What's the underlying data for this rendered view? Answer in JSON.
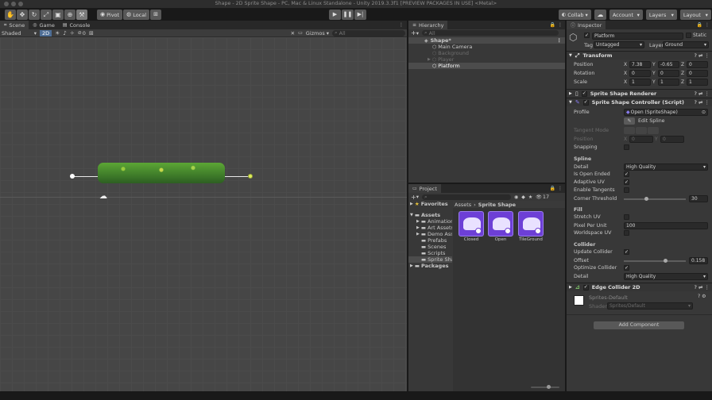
{
  "window": {
    "title": "Shape - 2D Sprite Shape - PC, Mac & Linux Standalone - Unity 2019.3.3f1 [PREVIEW PACKAGES IN USE] <Metal>"
  },
  "toolbar": {
    "pivot": "Pivot",
    "local": "Local",
    "collab": "Collab ▾",
    "account": "Account",
    "layers": "Layers",
    "layout": "Layout"
  },
  "scene": {
    "tabs": [
      "Scene",
      "Game",
      "Console"
    ],
    "shading": "Shaded",
    "mode_2d": "2D",
    "fx_count": "0",
    "gizmos": "Gizmos",
    "search": "All"
  },
  "hierarchy": {
    "title": "Hierarchy",
    "search": "All",
    "scene": "Shape*",
    "items": [
      {
        "label": "Main Camera",
        "disabled": false
      },
      {
        "label": "Background",
        "disabled": true
      },
      {
        "label": "Player",
        "disabled": true
      },
      {
        "label": "Platform",
        "disabled": false
      }
    ]
  },
  "project": {
    "title": "Project",
    "count": "17",
    "favorites": "Favorites",
    "assets": "Assets",
    "folders": [
      "Animation",
      "Art Assets",
      "Demo Asse",
      "Prefabs",
      "Scenes",
      "Scripts",
      "Sprite Shap"
    ],
    "packages": "Packages",
    "breadcrumb": [
      "Assets",
      "Sprite Shape"
    ],
    "files": [
      "Closed",
      "Open",
      "TileGround"
    ]
  },
  "inspector": {
    "title": "Inspector",
    "name": "Platform",
    "static": "Static",
    "tag_label": "Tag",
    "tag": "Untagged",
    "layer_label": "Layer",
    "layer": "Ground",
    "transform": {
      "title": "Transform",
      "position_label": "Position",
      "rotation_label": "Rotation",
      "scale_label": "Scale",
      "position": {
        "x": "7.38",
        "y": "-0.65",
        "z": "0"
      },
      "rotation": {
        "x": "0",
        "y": "0",
        "z": "0"
      },
      "scale": {
        "x": "1",
        "y": "1",
        "z": "1"
      }
    },
    "renderer": "Sprite Shape Renderer",
    "controller": {
      "title": "Sprite Shape Controller (Script)",
      "profile_label": "Profile",
      "profile": "Open (SpriteShape)",
      "edit_spline": "Edit Spline",
      "tangent_mode": "Tangent Mode",
      "position_label": "Position",
      "pos_x": "0",
      "pos_y": "0",
      "snapping": "Snapping"
    },
    "spline": {
      "title": "Spline",
      "detail_label": "Detail",
      "detail": "High Quality",
      "open_ended": "Is Open Ended",
      "adaptive_uv": "Adaptive UV",
      "enable_tangents": "Enable Tangents",
      "corner_threshold": "Corner Threshold",
      "corner_value": "30"
    },
    "fill": {
      "title": "Fill",
      "stretch_uv": "Stretch UV",
      "ppu_label": "Pixel Per Unit",
      "ppu": "100",
      "worldspace": "Worldspace UV"
    },
    "collider": {
      "title": "Collider",
      "update": "Update Collider",
      "offset_label": "Offset",
      "offset": "0.158",
      "optimize": "Optimize Collider",
      "detail_label": "Detail",
      "detail": "High Quality"
    },
    "edge": "Edge Collider 2D",
    "material": {
      "name": "Sprites-Default",
      "shader_label": "Shader",
      "shader": "Sprites/Default"
    },
    "add_component": "Add Component"
  },
  "colors": {
    "accent": "#3a72b0",
    "selected": "#2c5d87",
    "bg": "#383838",
    "panel": "#282828"
  }
}
